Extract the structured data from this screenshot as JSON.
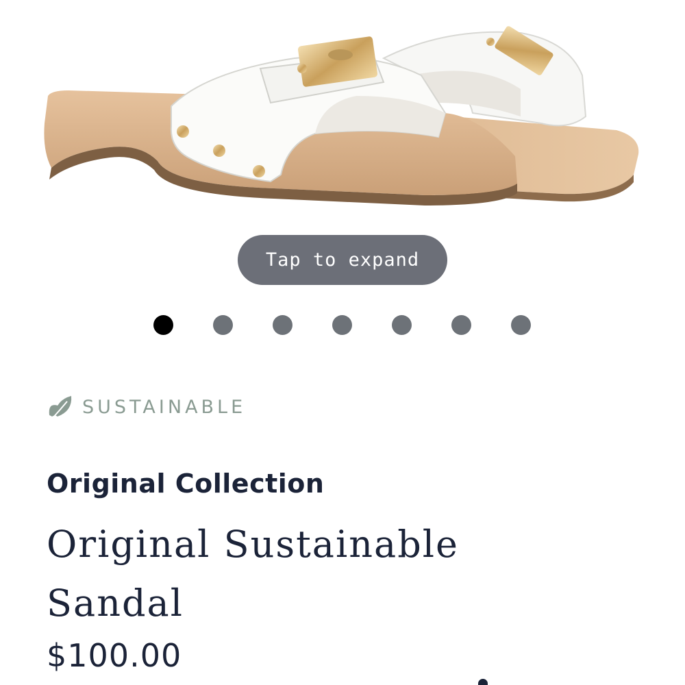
{
  "product_image": {
    "icon": "sandal-product-photo",
    "alt": "white leather buckle sandals with wooden sole"
  },
  "gallery": {
    "expand_label": "Tap to expand",
    "dots_count": 7,
    "active_index": 0
  },
  "badge": {
    "icon": "leaf-icon",
    "label": "SUSTAINABLE"
  },
  "product": {
    "collection": "Original Collection",
    "name": "Original Sustainable Sandal",
    "price": "$100.00"
  },
  "colors": {
    "text": "#1b2338",
    "badge": "#8a9b92",
    "pill": "#6c6f78",
    "dot": "#6d7278",
    "dot_active": "#000000"
  }
}
